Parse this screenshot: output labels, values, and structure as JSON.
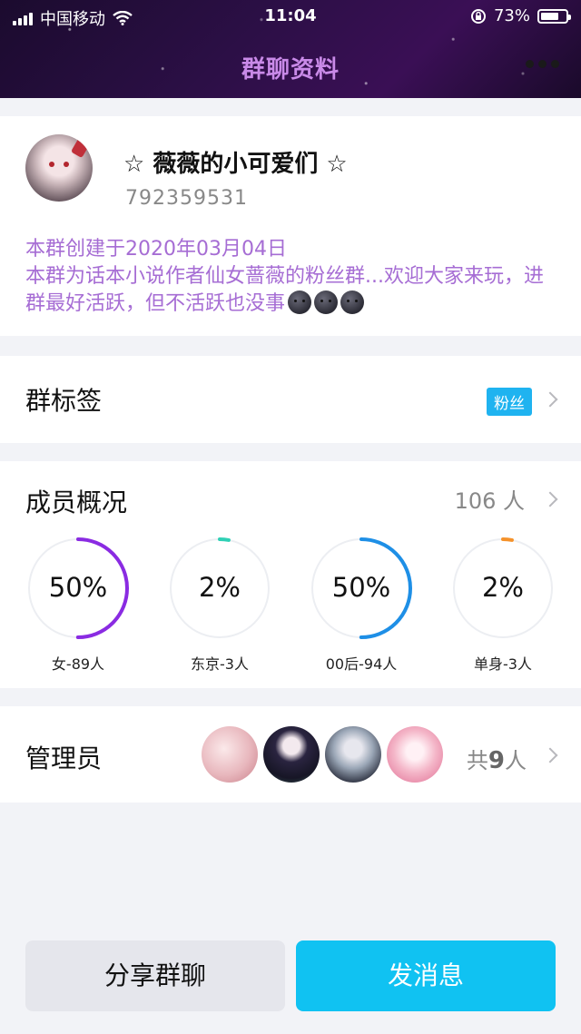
{
  "status_bar": {
    "carrier": "中国移动",
    "time": "11:04",
    "battery": "73%",
    "battery_level": 0.73
  },
  "header": {
    "title": "群聊资料"
  },
  "group": {
    "name": "☆ 薇薇的小可爱们 ☆",
    "id": "792359531",
    "created": "本群创建于2020年03月04日",
    "description": "本群为话本小说作者仙女蔷薇的粉丝群...欢迎大家来玩，进群最好活跃，但不活跃也没事"
  },
  "tags": {
    "title": "群标签",
    "badge": "粉丝"
  },
  "members": {
    "title": "成员概况",
    "count": "106 人",
    "stats": [
      {
        "percent": "50%",
        "label": "女-89人",
        "fraction": 0.5,
        "color": "#8a2be2"
      },
      {
        "percent": "2%",
        "label": "东京-3人",
        "fraction": 0.02,
        "color": "#2fd0b5"
      },
      {
        "percent": "50%",
        "label": "00后-94人",
        "fraction": 0.5,
        "color": "#1e8fe6"
      },
      {
        "percent": "2%",
        "label": "单身-3人",
        "fraction": 0.02,
        "color": "#f5922a"
      }
    ]
  },
  "admins": {
    "title": "管理员",
    "count_prefix": "共",
    "count": "9",
    "count_suffix": "人"
  },
  "actions": {
    "share": "分享群聊",
    "send": "发消息"
  }
}
